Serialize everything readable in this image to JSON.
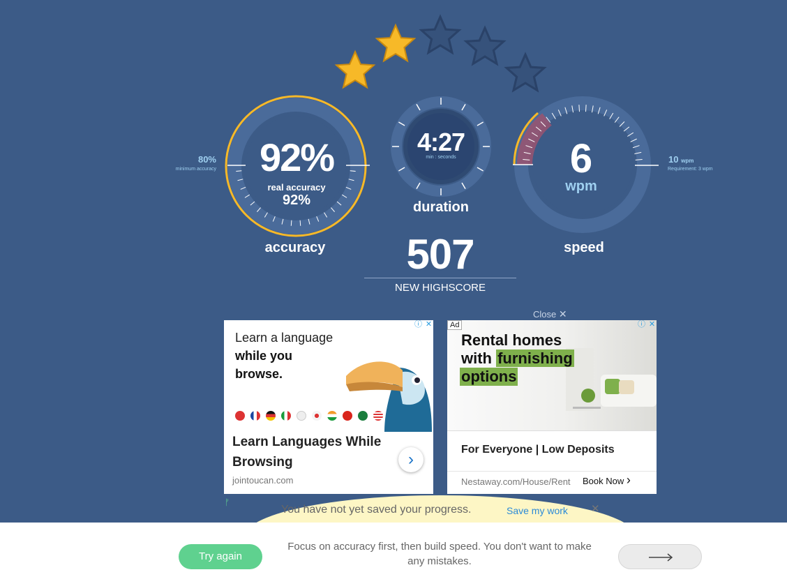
{
  "stars": {
    "filled": 2,
    "total": 5
  },
  "accuracy": {
    "value": "92%",
    "real_label": "real accuracy",
    "real_value": "92%",
    "label": "accuracy",
    "min_value": "80%",
    "min_label": "minimum accuracy"
  },
  "duration": {
    "value": "4:27",
    "unit": "min : seconds",
    "label": "duration"
  },
  "speed": {
    "value": "6",
    "unit": "wpm",
    "label": "speed",
    "side_value": "10",
    "side_unit": "wpm",
    "requirement": "Requirement: 3 wpm"
  },
  "score": {
    "value": "507",
    "label": "NEW HIGHSCORE"
  },
  "ads": {
    "close_label": "Close",
    "ad_badge": "Ad",
    "left": {
      "line1": "Learn a language",
      "line2": "while you",
      "line3": "browse.",
      "headline": "Learn Languages While Browsing",
      "domain": "jointoucan.com"
    },
    "right": {
      "line1": "Rental homes",
      "line2a": "with ",
      "line2b": "furnishing",
      "line3": "options",
      "headline": "For Everyone | Low Deposits",
      "domain": "Nestaway.com/House/Rent",
      "cta": "Book Now"
    }
  },
  "banner": {
    "message": "You have not yet saved your progress.",
    "save_link": "Save my work"
  },
  "footer": {
    "try_again": "Try again",
    "tip": "Focus on accuracy first, then build speed. You don't want to make any mistakes."
  },
  "colors": {
    "background": "#3c5b87",
    "gold": "#f7b928",
    "accent_green": "#5fd18f",
    "speed_red": "#9a5470"
  },
  "icons": {
    "star": "star-icon",
    "next": "arrow-right-icon",
    "close": "close-icon",
    "chevron": "chevron-right-icon"
  }
}
